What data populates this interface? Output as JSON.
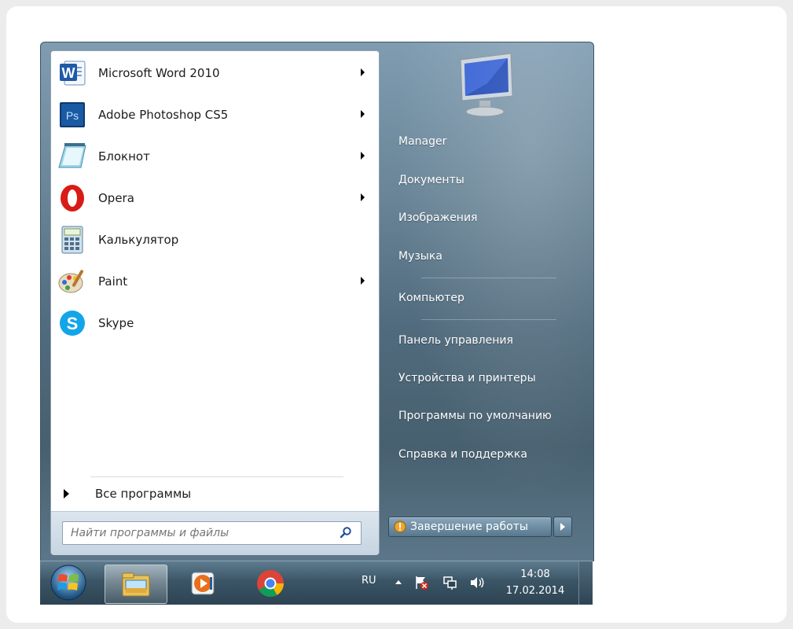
{
  "programs": [
    {
      "label": "Microsoft Word 2010",
      "icon": "word-icon",
      "has_submenu": true
    },
    {
      "label": "Adobe Photoshop CS5",
      "icon": "photoshop-icon",
      "has_submenu": true
    },
    {
      "label": "Блокнот",
      "icon": "notepad-icon",
      "has_submenu": true
    },
    {
      "label": "Opera",
      "icon": "opera-icon",
      "has_submenu": true
    },
    {
      "label": "Калькулятор",
      "icon": "calculator-icon",
      "has_submenu": false
    },
    {
      "label": "Paint",
      "icon": "paint-icon",
      "has_submenu": true
    },
    {
      "label": "Skype",
      "icon": "skype-icon",
      "has_submenu": false
    }
  ],
  "all_programs": {
    "label": "Все программы"
  },
  "search": {
    "placeholder": "Найти программы и файлы",
    "value": ""
  },
  "right_pane": {
    "user": "Manager",
    "documents": "Документы",
    "pictures": "Изображения",
    "music": "Музыка",
    "computer": "Компьютер",
    "control_panel": "Панель управления",
    "devices": "Устройства и принтеры",
    "default_programs": "Программы по умолчанию",
    "help": "Справка и поддержка"
  },
  "shutdown": {
    "label": "Завершение работы"
  },
  "taskbar": {
    "pinned": [
      "explorer-icon",
      "media-player-icon",
      "chrome-icon"
    ],
    "language": "RU",
    "time": "14:08",
    "date": "17.02.2014"
  },
  "colors": {
    "menu_glass": "#6a8698",
    "taskbar": "#3b5566",
    "left_pane": "#ffffff",
    "text_dark": "#1c1c1c",
    "text_light": "#ffffff"
  }
}
